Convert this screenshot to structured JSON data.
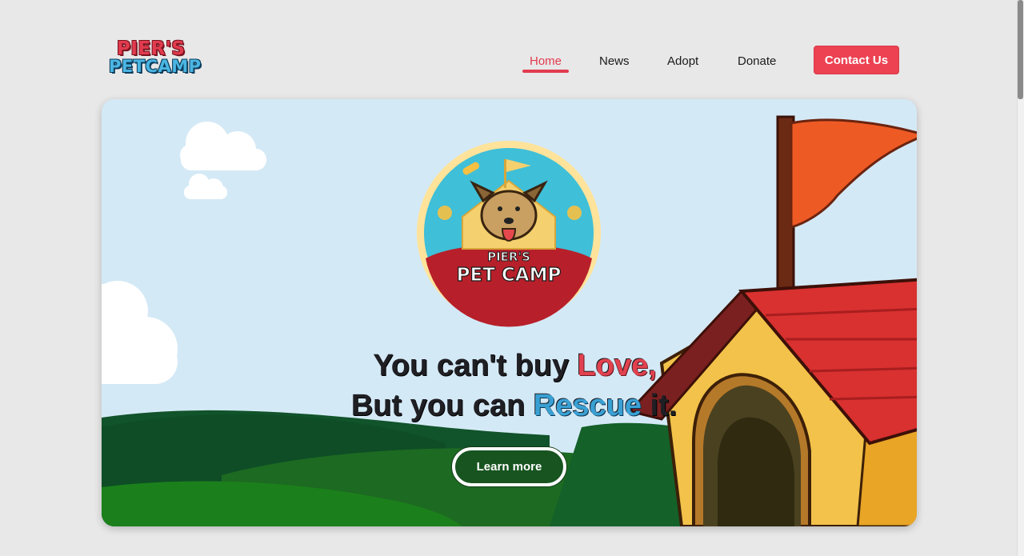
{
  "brand": {
    "logo_line1": "PIER'S",
    "logo_line2": "PETCAMP",
    "badge_line1": "PIER'S",
    "badge_line2": "PET CAMP",
    "primary_color": "#e23b4e",
    "secondary_color": "#4bb6e3"
  },
  "nav": {
    "items": [
      {
        "label": "Home",
        "active": true
      },
      {
        "label": "News",
        "active": false
      },
      {
        "label": "Adopt",
        "active": false
      },
      {
        "label": "Donate",
        "active": false
      }
    ],
    "contact_label": "Contact Us"
  },
  "hero": {
    "line1_prefix": "You can't buy ",
    "line1_highlight": "Love,",
    "line2_prefix": "But you can ",
    "line2_highlight": "Rescue",
    "line2_suffix": " it.",
    "cta_label": "Learn more",
    "colors": {
      "sky": "#d4e9f6",
      "hill_dark": "#0f4a22",
      "hill_light": "#1c7d1c",
      "flag": "#ee5a24",
      "roof": "#d93030",
      "doghouse": "#f2c24a"
    }
  }
}
